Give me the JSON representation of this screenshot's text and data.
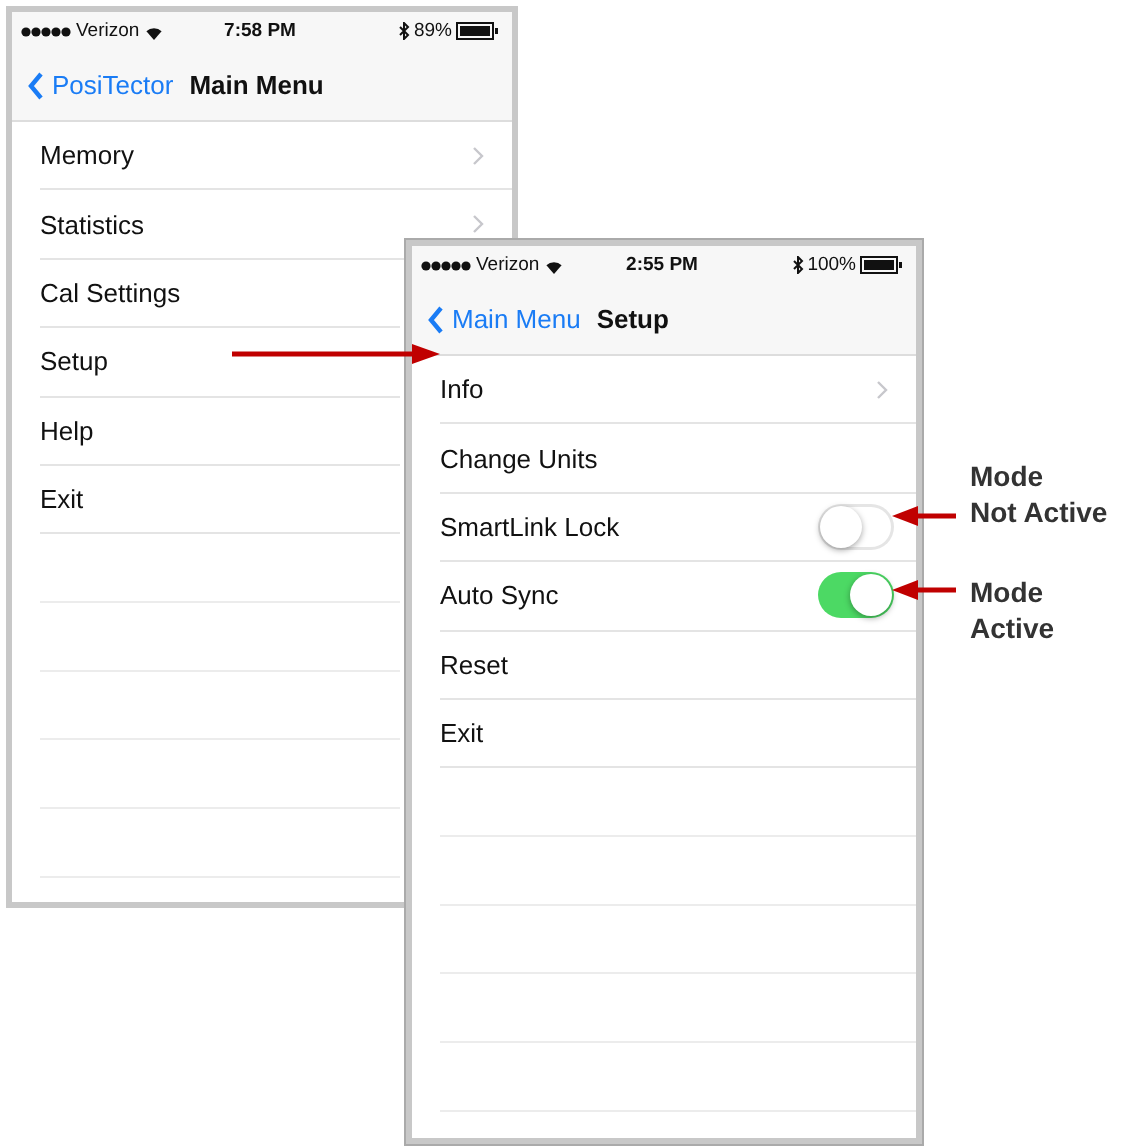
{
  "screens": [
    {
      "status": {
        "carrier": "Verizon",
        "time": "7:58 PM",
        "battery": "89%"
      },
      "nav": {
        "back": "PosiTector",
        "title": "Main Menu"
      },
      "rows": [
        {
          "label": "Memory",
          "kind": "disclosure"
        },
        {
          "label": "Statistics",
          "kind": "disclosure"
        },
        {
          "label": "Cal Settings",
          "kind": "plain"
        },
        {
          "label": "Setup",
          "kind": "plain"
        },
        {
          "label": "Help",
          "kind": "plain"
        },
        {
          "label": "Exit",
          "kind": "plain"
        }
      ]
    },
    {
      "status": {
        "carrier": "Verizon",
        "time": "2:55 PM",
        "battery": "100%"
      },
      "nav": {
        "back": "Main Menu",
        "title": "Setup"
      },
      "rows": [
        {
          "label": "Info",
          "kind": "disclosure"
        },
        {
          "label": "Change Units",
          "kind": "plain"
        },
        {
          "label": "SmartLink Lock",
          "kind": "toggle",
          "on": false
        },
        {
          "label": "Auto Sync",
          "kind": "toggle",
          "on": true
        },
        {
          "label": "Reset",
          "kind": "plain"
        },
        {
          "label": "Exit",
          "kind": "plain"
        }
      ]
    }
  ],
  "callouts": [
    {
      "lines": [
        "Mode",
        "Not Active"
      ]
    },
    {
      "lines": [
        "Mode",
        "Active"
      ]
    }
  ]
}
